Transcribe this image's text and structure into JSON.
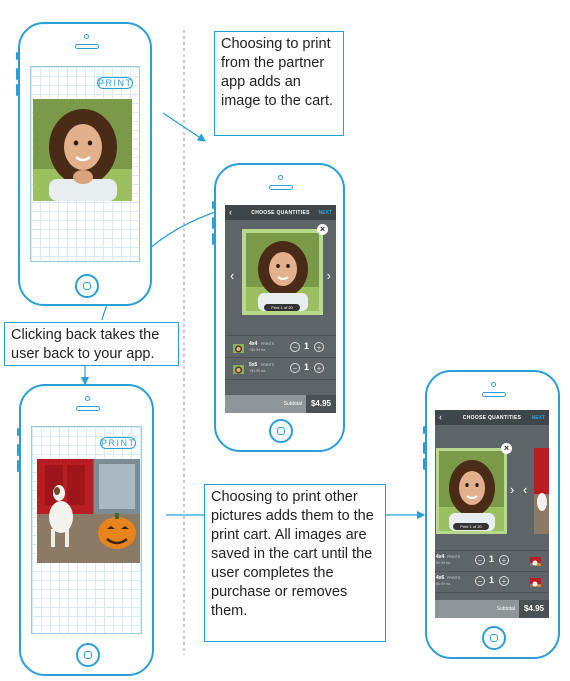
{
  "phone_left_top": {
    "print_label": "PRINT"
  },
  "phone_left_bottom": {
    "print_label": "PRINT"
  },
  "callouts": {
    "partner_app": "Choosing to print from the partner app adds an image to the cart.",
    "back": "Clicking back takes the user back to your app.",
    "print_other": "Choosing to print other pictures adds them to the print cart. All images are saved in the cart until the user completes the purchase or removes them."
  },
  "cart_middle": {
    "title": "CHOOSE QUANTITIES",
    "next_label": "NEXT",
    "page_indicator": "Print 1 of 20",
    "rows": [
      {
        "size": "4x4",
        "unit": "PRINTS",
        "price_each": "+$0.99 ea.",
        "qty": "1"
      },
      {
        "size": "5x5",
        "unit": "PRINTS",
        "price_each": "+$1.00 ea.",
        "qty": "1"
      }
    ],
    "subtotal_label": "Subtotal",
    "subtotal": "$4.95"
  },
  "cart_right": {
    "title": "CHOOSE QUANTITIES",
    "next_label": "NEXT",
    "page_indicator": "Print 1 of 20",
    "rows": [
      {
        "size": "4x4",
        "unit": "PRINTS",
        "price_each": "$0.99 ea.",
        "qty": "1"
      },
      {
        "size": "4x6",
        "unit": "PRINTS",
        "price_each": "$0.99 ea.",
        "qty": "1"
      }
    ],
    "subtotal_label": "Subtotal",
    "subtotal": "$4.95"
  },
  "colors": {
    "accent": "#2a9fd6",
    "screen_dark": "#5d6568",
    "photo_card": "#b7d88d"
  }
}
